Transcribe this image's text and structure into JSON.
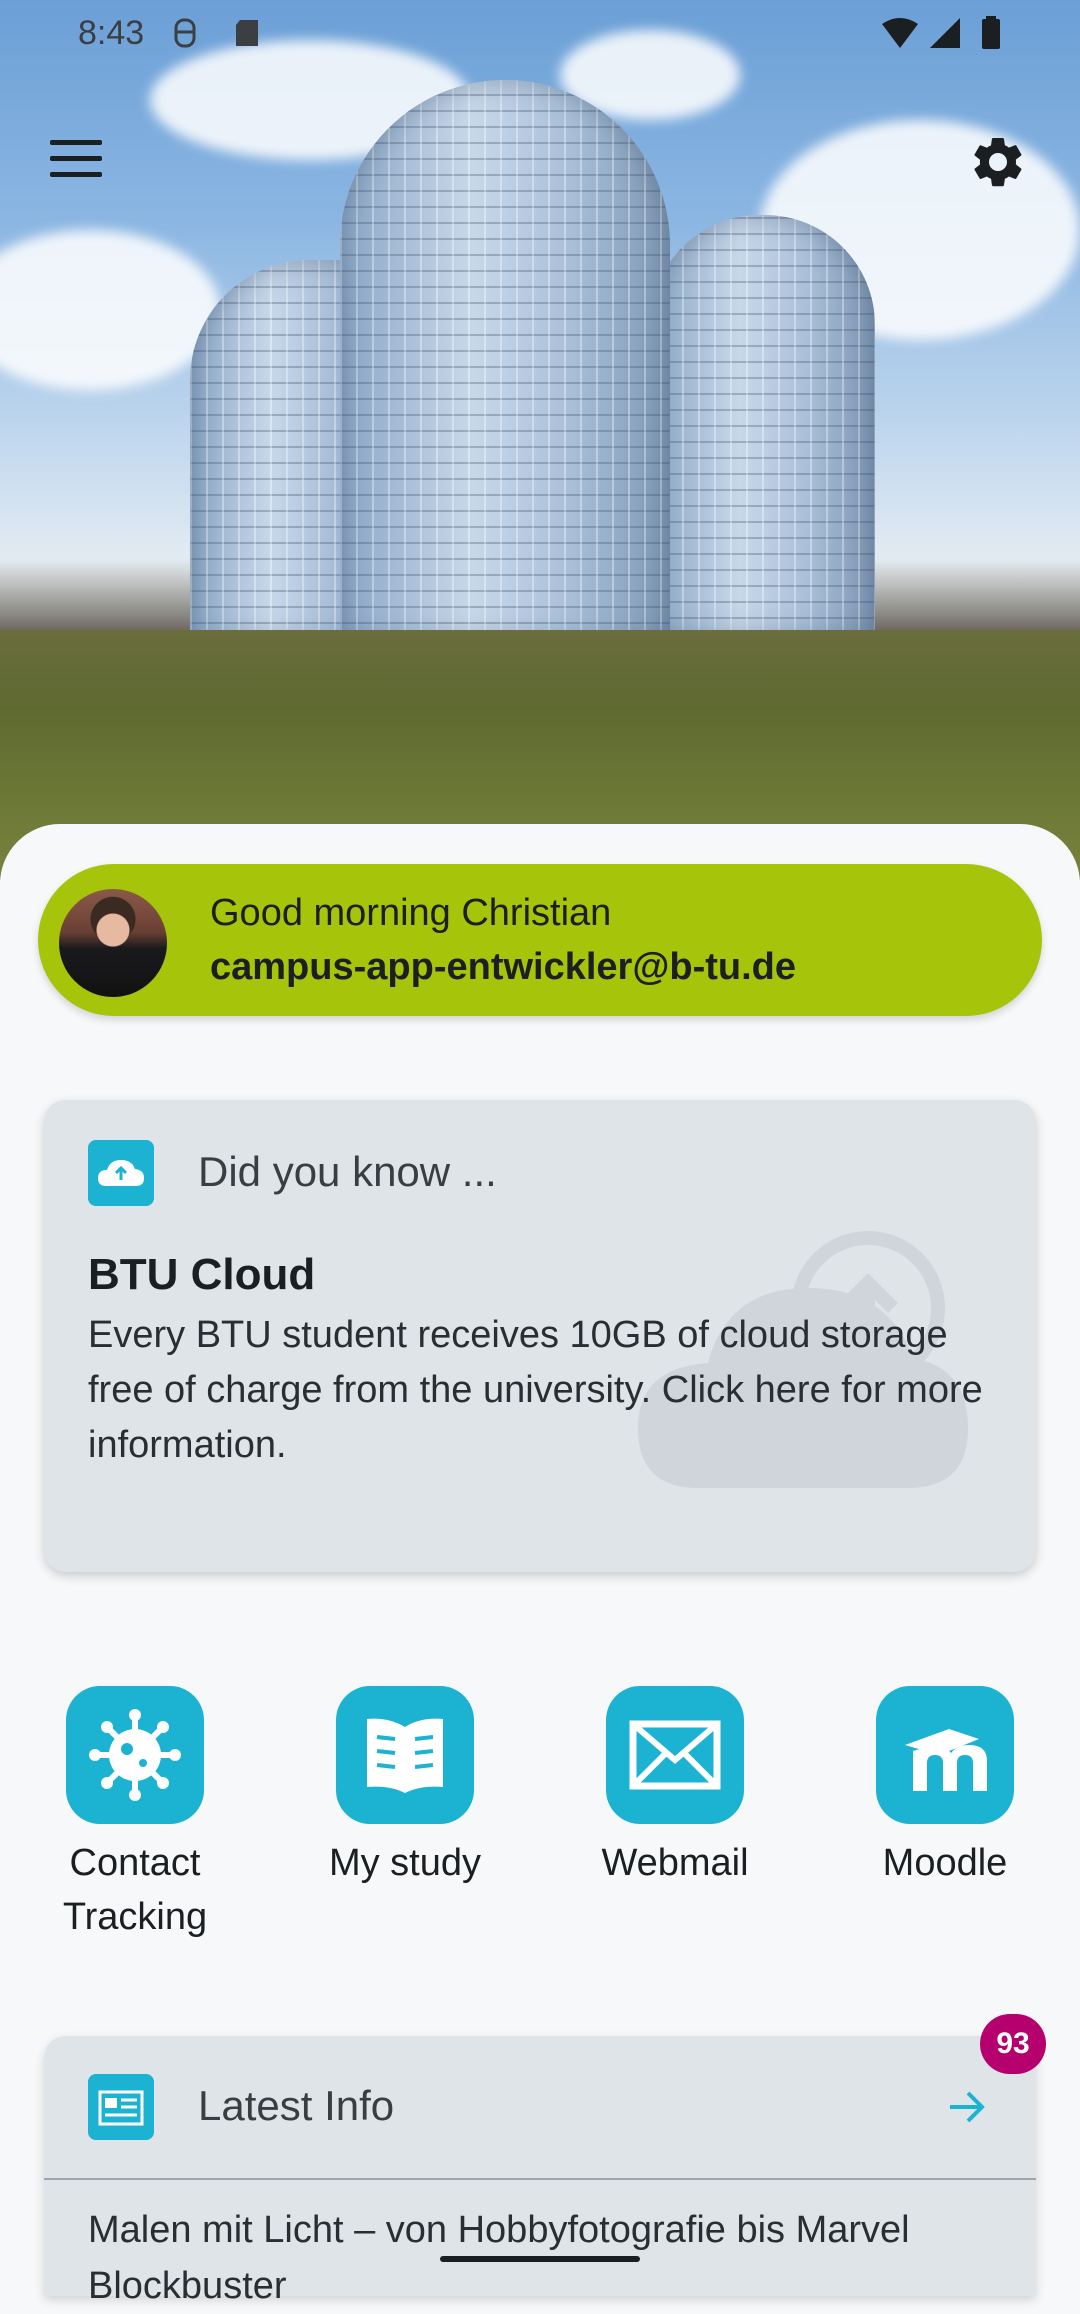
{
  "status_bar": {
    "time": "8:43"
  },
  "greeting": {
    "hello": "Good morning Christian",
    "email": "campus-app-entwickler@b-tu.de"
  },
  "did_you_know": {
    "heading": "Did you know ...",
    "title": "BTU Cloud",
    "body": "Every BTU student receives 10GB of cloud storage free of charge from the university. Click here for more information."
  },
  "tiles": [
    {
      "label": "Contact Tracking",
      "icon": "virus-icon"
    },
    {
      "label": "My study",
      "icon": "book-icon"
    },
    {
      "label": "Webmail",
      "icon": "mail-icon"
    },
    {
      "label": "Moodle",
      "icon": "moodle-icon"
    }
  ],
  "latest_info": {
    "heading": "Latest Info",
    "badge": "93",
    "first_item": "Malen mit Licht – von Hobbyfotografie bis Marvel Blockbuster"
  },
  "colors": {
    "accent": "#1cb3d3",
    "greeting_bg": "#a5c40a",
    "badge": "#b5006e"
  }
}
